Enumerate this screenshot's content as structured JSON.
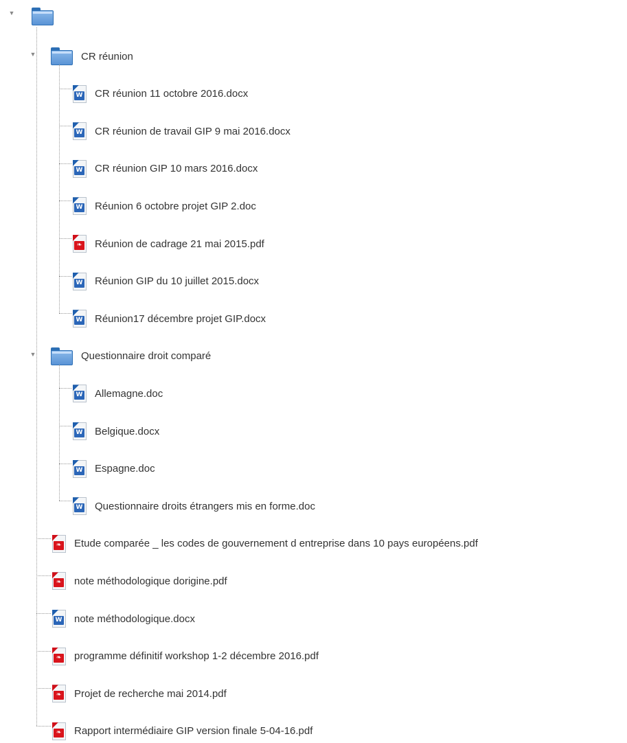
{
  "tree": {
    "root": {
      "icon": "folder-icon",
      "expand_icon": "triangle-down-icon"
    },
    "folders": [
      {
        "label": "CR réunion",
        "icon": "folder-icon",
        "files": [
          {
            "label": "CR réunion 11 octobre 2016.docx",
            "icon": "word-document-icon"
          },
          {
            "label": "CR réunion de travail GIP 9 mai 2016.docx",
            "icon": "word-document-icon"
          },
          {
            "label": "CR réunion GIP 10 mars 2016.docx",
            "icon": "word-document-icon"
          },
          {
            "label": "Réunion 6 octobre projet GIP 2.doc",
            "icon": "word-document-icon"
          },
          {
            "label": "Réunion de cadrage 21 mai 2015.pdf",
            "icon": "pdf-document-icon"
          },
          {
            "label": "Réunion GIP du 10 juillet 2015.docx",
            "icon": "word-document-icon"
          },
          {
            "label": "Réunion17 décembre projet GIP.docx",
            "icon": "word-document-icon"
          }
        ]
      },
      {
        "label": "Questionnaire droit comparé",
        "icon": "folder-icon",
        "files": [
          {
            "label": "Allemagne.doc",
            "icon": "word-document-icon"
          },
          {
            "label": "Belgique.docx",
            "icon": "word-document-icon"
          },
          {
            "label": "Espagne.doc",
            "icon": "word-document-icon"
          },
          {
            "label": "Questionnaire droits étrangers mis en forme.doc",
            "icon": "word-document-icon"
          }
        ]
      }
    ],
    "files": [
      {
        "label": "Etude comparée _ les codes de gouvernement d entreprise dans 10 pays européens.pdf",
        "icon": "pdf-document-icon"
      },
      {
        "label": "note méthodologique dorigine.pdf",
        "icon": "pdf-document-icon"
      },
      {
        "label": "note méthodologique.docx",
        "icon": "word-document-icon"
      },
      {
        "label": "programme définitif workshop 1-2 décembre 2016.pdf",
        "icon": "pdf-document-icon"
      },
      {
        "label": "Projet de recherche mai 2014.pdf",
        "icon": "pdf-document-icon"
      },
      {
        "label": "Rapport intermédiaire GIP version finale 5-04-16.pdf",
        "icon": "pdf-document-icon"
      }
    ]
  }
}
